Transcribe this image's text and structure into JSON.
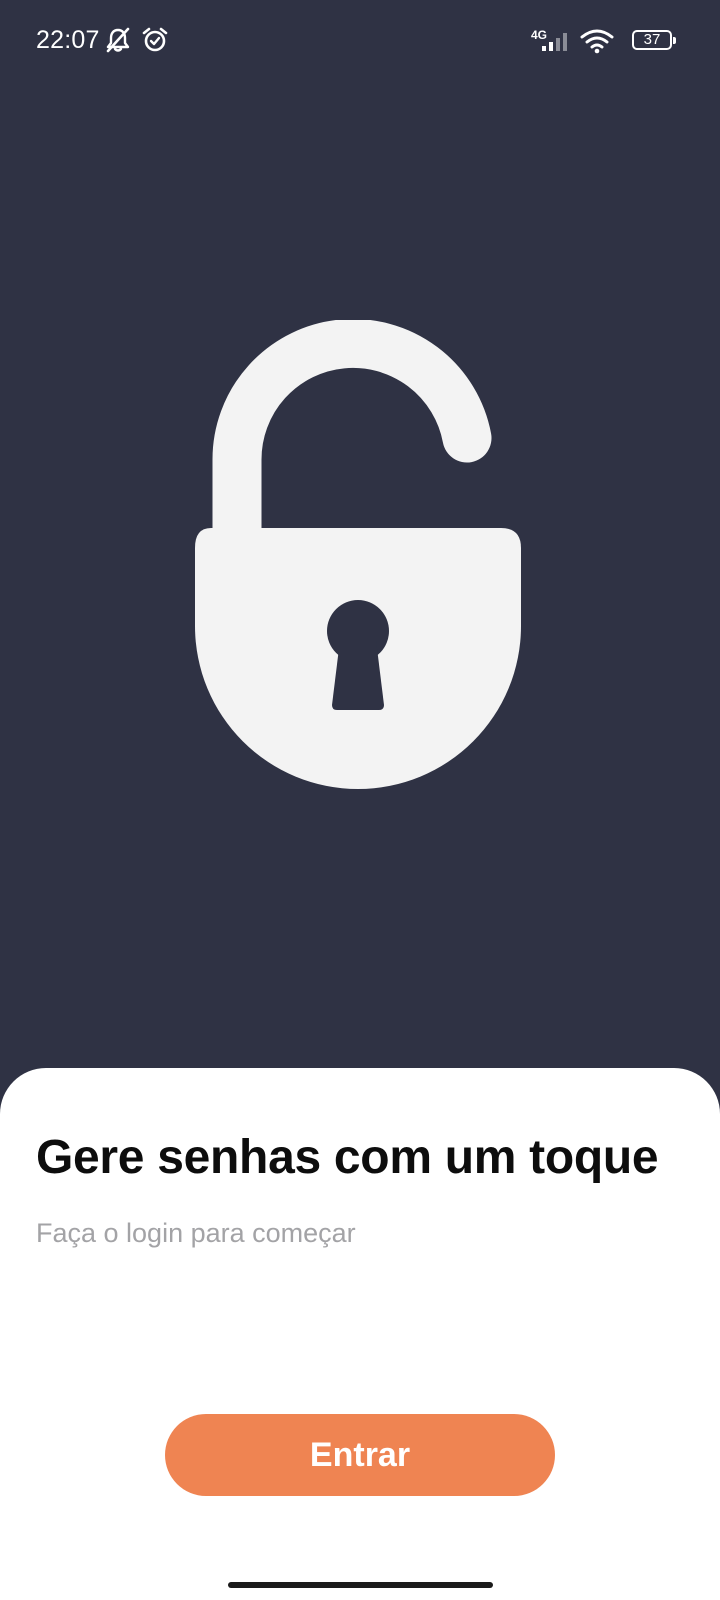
{
  "status_bar": {
    "time": "22:07",
    "network": "4G",
    "battery": "37",
    "icons": [
      "mute-icon",
      "alarm-icon",
      "signal-icon",
      "wifi-icon",
      "battery-icon"
    ]
  },
  "hero": {
    "icon": "unlocked-padlock-icon"
  },
  "sheet": {
    "title": "Gere senhas com um toque",
    "subtitle": "Faça o login para começar",
    "button_label": "Entrar"
  },
  "colors": {
    "background": "#2f3244",
    "sheet": "#ffffff",
    "accent": "#ef8452",
    "lock": "#f3f3f3",
    "title": "#0d0d0d",
    "subtitle": "#a3a3a6"
  }
}
